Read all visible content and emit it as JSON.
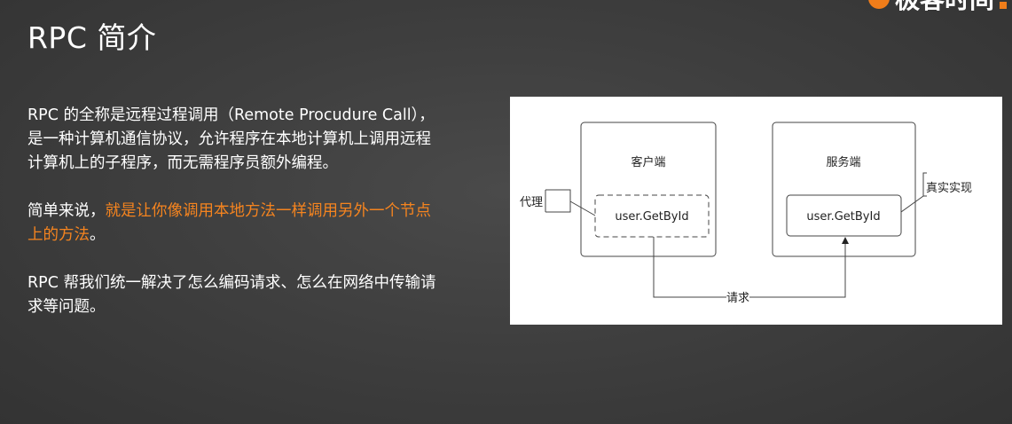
{
  "slide": {
    "title": "RPC 简介",
    "logo_text": "极客时间"
  },
  "paragraphs": {
    "p1": "RPC 的全称是远程过程调用（Remote Procudure Call），是一种计算机通信协议，允许程序在本地计算机上调用远程计算机上的子程序，而无需程序员额外编程。",
    "p2_prefix": "简单来说，",
    "p2_highlight": "就是让你像调用本地方法一样调用另外一个节点上的方法",
    "p2_suffix": "。",
    "p3": "RPC 帮我们统一解决了怎么编码请求、怎么在网络中传输请求等问题。"
  },
  "diagram": {
    "client_label": "客户端",
    "server_label": "服务端",
    "client_method": "user.GetById",
    "server_method": "user.GetById",
    "proxy_label": "代理",
    "impl_label": "真实实现",
    "request_label": "请求"
  },
  "colors": {
    "highlight": "#f5841f",
    "background": "#3f3f3f"
  }
}
